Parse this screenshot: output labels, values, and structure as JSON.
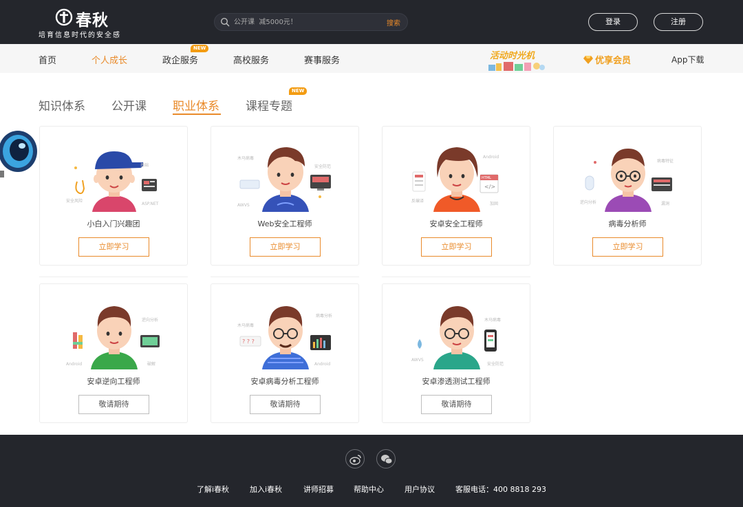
{
  "header": {
    "logo_name": "春秋",
    "logo_slogan": "培育信息时代的安全感",
    "search_placeholder": "公开课  减5000元！",
    "search_button": "搜索",
    "login": "登录",
    "register": "注册"
  },
  "nav": {
    "items": [
      {
        "label": "首页"
      },
      {
        "label": "个人成长"
      },
      {
        "label": "政企服务"
      },
      {
        "label": "高校服务"
      },
      {
        "label": "赛事服务"
      }
    ],
    "new_badge": "NEW",
    "activity": "活动时光机",
    "vip": "优享会员",
    "app_download": "App下载"
  },
  "tabs": {
    "items": [
      {
        "label": "知识体系"
      },
      {
        "label": "公开课"
      },
      {
        "label": "职业体系"
      },
      {
        "label": "课程专题"
      }
    ],
    "new_badge": "NEW"
  },
  "cards": [
    {
      "title": "小白入门兴趣团",
      "button": "立即学习"
    },
    {
      "title": "Web安全工程师",
      "button": "立即学习"
    },
    {
      "title": "安卓安全工程师",
      "button": "立即学习"
    },
    {
      "title": "病毒分析师",
      "button": "立即学习"
    },
    {
      "title": "安卓逆向工程师",
      "button": "敬请期待"
    },
    {
      "title": "安卓病毒分析工程师",
      "button": "敬请期待"
    },
    {
      "title": "安卓渗透测试工程师",
      "button": "敬请期待"
    }
  ],
  "footer": {
    "links": [
      {
        "label": "了解i春秋"
      },
      {
        "label": "加入i春秋"
      },
      {
        "label": "讲师招募"
      },
      {
        "label": "帮助中心"
      },
      {
        "label": "用户协议"
      }
    ],
    "phone": "客服电话：400 8818 293"
  },
  "colors": {
    "accent": "#e98a2a",
    "header_bg": "#24262c",
    "nav_bg": "#f6f6f6"
  }
}
